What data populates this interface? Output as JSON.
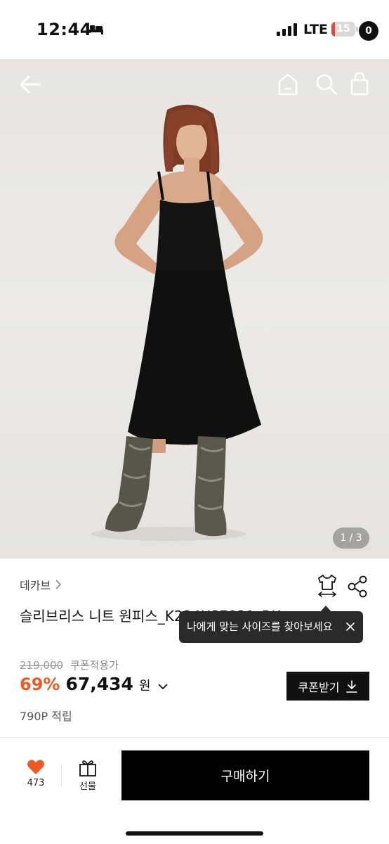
{
  "status_bar": {
    "time": "12:44",
    "network": "LTE",
    "battery_level": "15",
    "battery_fraction": 0.15
  },
  "header": {
    "cart_count": "0",
    "icons": [
      "back-icon",
      "home-icon",
      "search-icon",
      "bag-icon"
    ]
  },
  "gallery": {
    "counter": "1 / 3"
  },
  "product": {
    "brand": "데카브",
    "title": "슬리브리스 니트 원피스_K224KCE021_BK",
    "original_price": "219,000",
    "coupon_note": "쿠폰적용가",
    "discount_rate": "69%",
    "sale_price": "67,434",
    "price_unit": "원",
    "points": "790P 적립"
  },
  "tooltip": {
    "text": "나에게 맞는 사이즈를 찾아보세요"
  },
  "coupon_button": {
    "label": "쿠폰받기"
  },
  "bottom_bar": {
    "like_count": "473",
    "gift_label": "선물",
    "buy_label": "구매하기"
  },
  "colors": {
    "accent": "#ee5a24",
    "heart": "#ee5a24",
    "primary": "#000000",
    "battery_low": "#e5483b"
  }
}
